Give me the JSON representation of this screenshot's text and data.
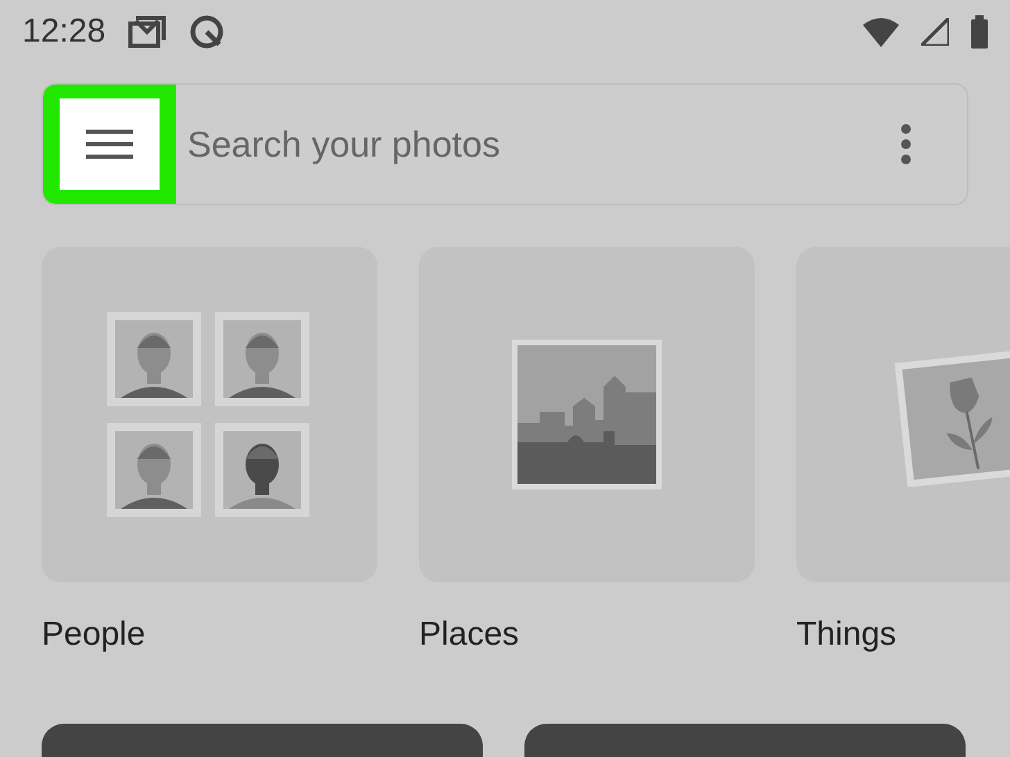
{
  "status_bar": {
    "time": "12:28"
  },
  "search": {
    "placeholder": "Search your photos",
    "menu_highlighted": true
  },
  "categories": [
    {
      "label": "People",
      "kind": "people"
    },
    {
      "label": "Places",
      "kind": "places"
    },
    {
      "label": "Things",
      "kind": "things"
    }
  ]
}
